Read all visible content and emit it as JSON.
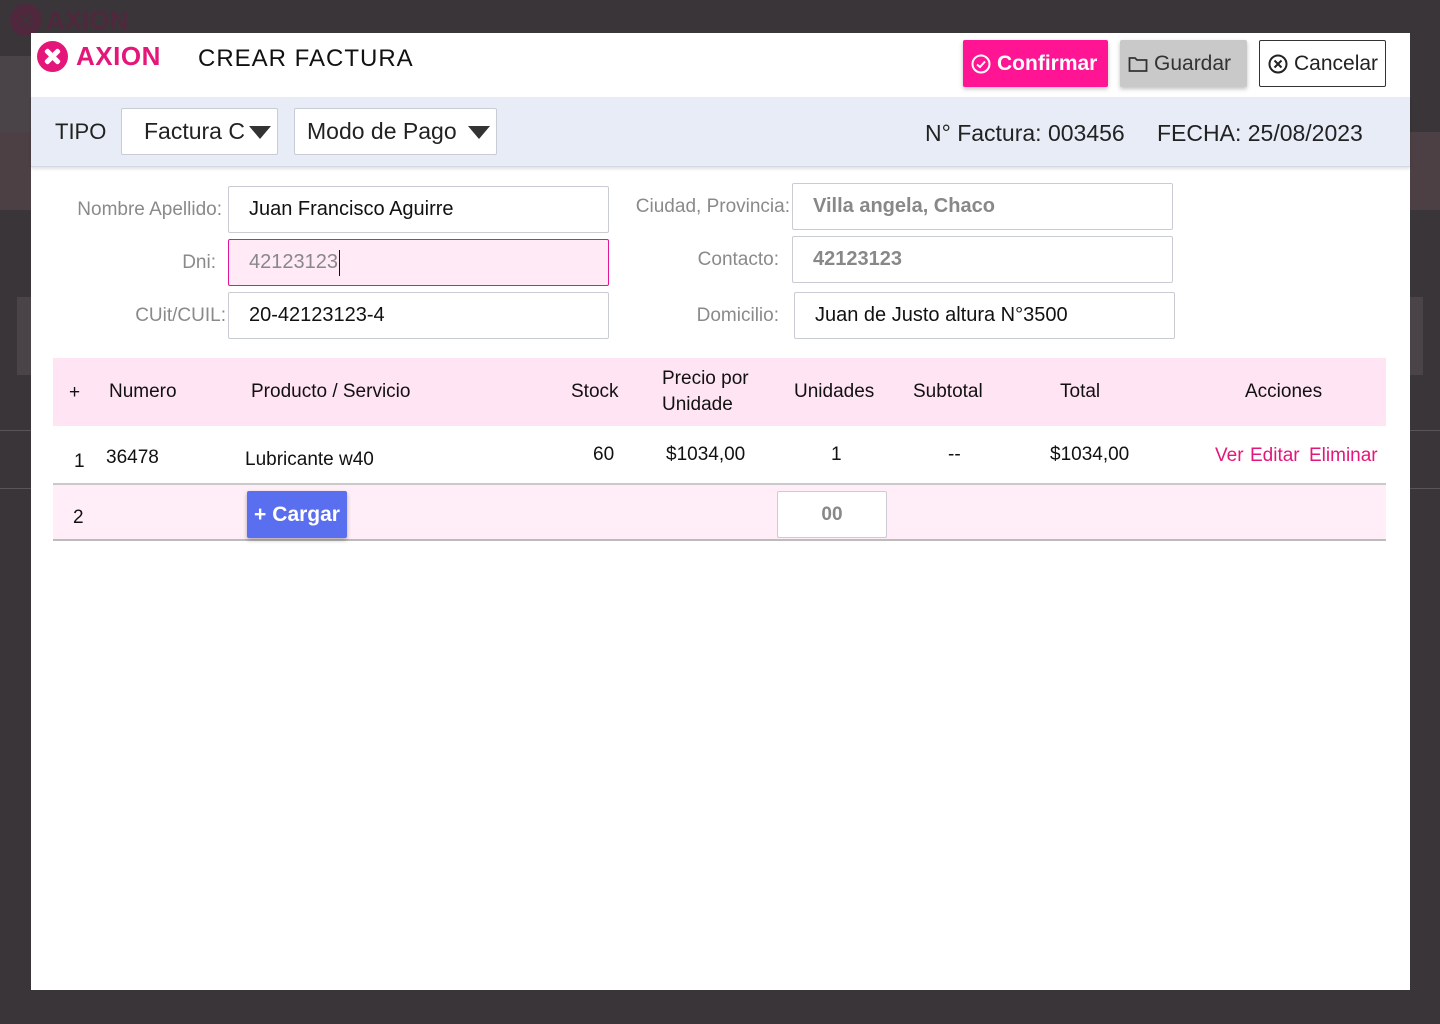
{
  "background": {
    "logo_text": "AXION"
  },
  "header": {
    "logo_text": "AXION",
    "title": "CREAR FACTURA",
    "confirm_label": "Confirmar",
    "save_label": "Guardar",
    "cancel_label": "Cancelar"
  },
  "filters": {
    "tipo_label": "TIPO",
    "tipo_value": "Factura C",
    "pago_value": "Modo de Pago",
    "invoice_number": "N° Factura: 003456",
    "date": "FECHA: 25/08/2023"
  },
  "form": {
    "nombre_label": "Nombre Apellido:",
    "nombre_value": "Juan Francisco Aguirre",
    "dni_label": "Dni:",
    "dni_value": "42123123",
    "cuit_label": "CUit/CUIL:",
    "cuit_value": "20-42123123-4",
    "ciudad_label": "Ciudad, Provincia:",
    "ciudad_value": "Villa angela, Chaco",
    "contacto_label": "Contacto:",
    "contacto_value": "42123123",
    "domicilio_label": "Domicilio:",
    "domicilio_value": "Juan de Justo altura N°3500"
  },
  "table": {
    "headers": {
      "add": "+",
      "numero": "Numero",
      "producto": "Producto / Servicio",
      "stock": "Stock",
      "precio_line1": "Precio por",
      "precio_line2": "Unidade",
      "unidades": "Unidades",
      "subtotal": "Subtotal",
      "total": "Total",
      "acciones": "Acciones"
    },
    "rows": [
      {
        "index": "1",
        "numero": "36478",
        "producto": "Lubricante w40",
        "stock": "60",
        "precio": "$1034,00",
        "unidades": "1",
        "subtotal": "--",
        "total": "$1034,00",
        "ver": "Ver",
        "editar": "Editar",
        "eliminar": "Eliminar"
      }
    ],
    "new_row": {
      "index": "2",
      "cargar_label": "Cargar",
      "qty_value": "00"
    }
  },
  "colors": {
    "accent": "#e5167a",
    "confirm": "#ff1493",
    "cargar": "#5a6ef0",
    "header_row": "#ffe4f3",
    "filter_bar": "#e7ecf6"
  }
}
